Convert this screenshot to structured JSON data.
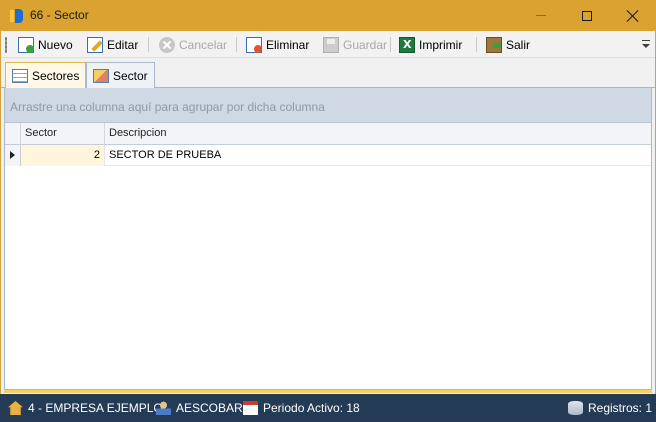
{
  "window": {
    "title": "66 - Sector",
    "controls": {
      "minimize": "minimize",
      "maximize": "maximize",
      "close": "close"
    }
  },
  "toolbar": {
    "buttons": [
      {
        "label": "Nuevo",
        "icon": "new-document-icon",
        "enabled": true
      },
      {
        "label": "Editar",
        "icon": "edit-icon",
        "enabled": true
      },
      {
        "label": "Cancelar",
        "icon": "cancel-icon",
        "enabled": false
      },
      {
        "label": "Eliminar",
        "icon": "delete-icon",
        "enabled": true
      },
      {
        "label": "Guardar",
        "icon": "save-icon",
        "enabled": false
      },
      {
        "label": "Imprimir",
        "icon": "excel-print-icon",
        "enabled": true
      },
      {
        "label": "Salir",
        "icon": "exit-icon",
        "enabled": true
      }
    ]
  },
  "tabs": [
    {
      "label": "Sectores",
      "icon": "grid-icon",
      "active": true
    },
    {
      "label": "Sector",
      "icon": "form-icon",
      "active": false
    }
  ],
  "grid": {
    "group_panel_text": "Arrastre una columna aquí para agrupar por dicha columna",
    "columns": [
      "Sector",
      "Descripcion"
    ],
    "rows": [
      {
        "sector": "2",
        "descripcion": "SECTOR DE PRUEBA"
      }
    ]
  },
  "statusbar": {
    "company": "4 - EMPRESA EJEMPLO",
    "user": "AESCOBAR",
    "period": "Periodo Activo: 18",
    "records": "Registros: 1"
  },
  "colors": {
    "title_bar": "#d9a231",
    "status_bar": "#243b55",
    "active_tab": "#fff8e6",
    "group_panel": "#cfd8e3"
  }
}
